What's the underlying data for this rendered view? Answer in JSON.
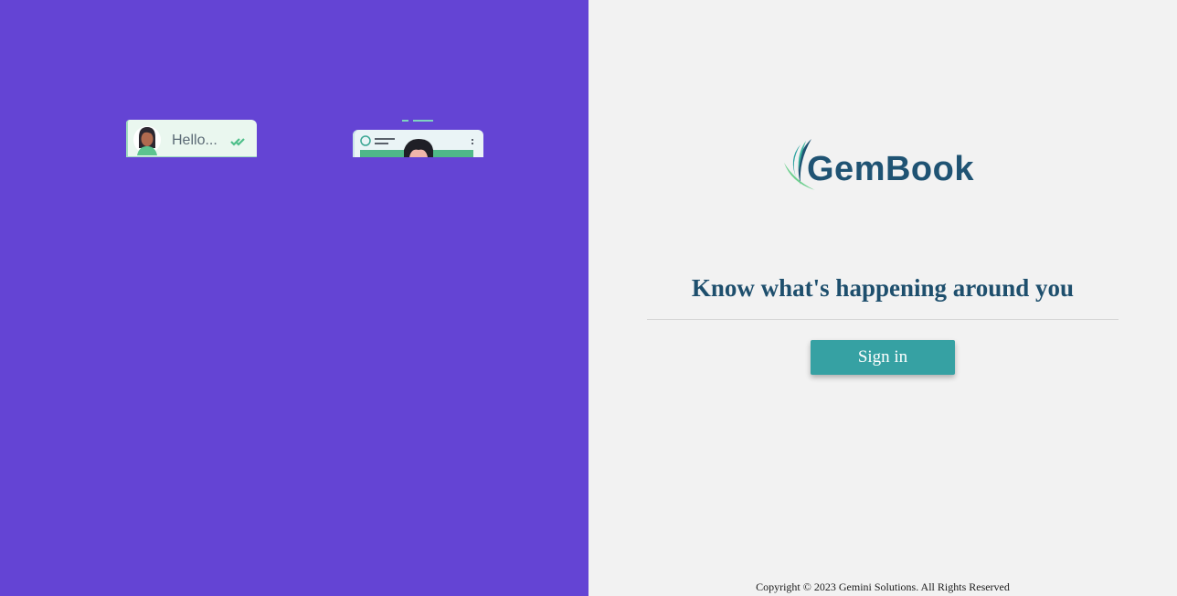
{
  "illustration": {
    "chat_text": "Hello..."
  },
  "brand": {
    "name": "GemBook",
    "color": "#1f5373"
  },
  "main": {
    "tagline": "Know what's happening around you",
    "signin_label": "Sign in"
  },
  "footer": {
    "copyright": "Copyright © 2023 Gemini Solutions. All Rights Reserved"
  },
  "colors": {
    "left_panel": "#6444d4",
    "right_panel": "#f2f2f2",
    "button": "#36a1a3",
    "heading": "#1e4f6d"
  }
}
